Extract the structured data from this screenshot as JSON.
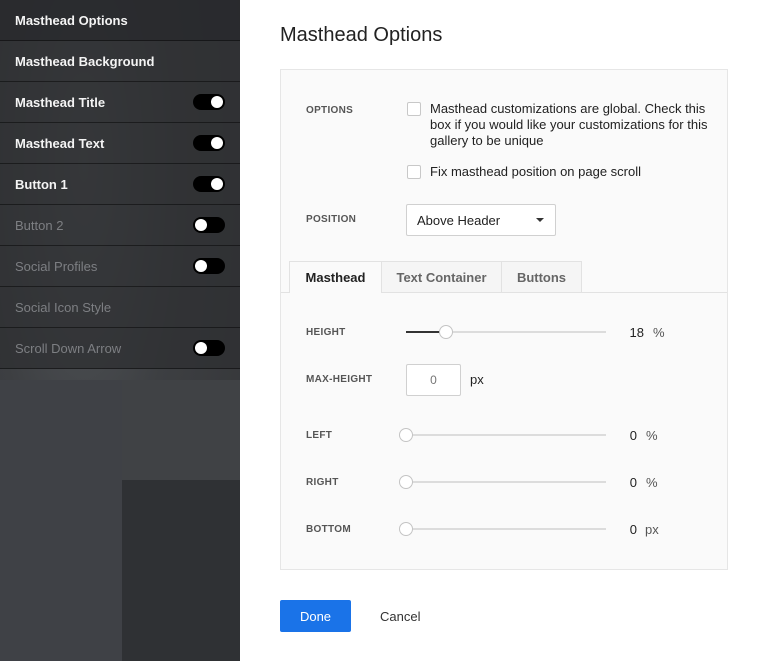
{
  "sidebar": {
    "items": [
      {
        "label": "Masthead Options",
        "toggle": null,
        "enabled": true
      },
      {
        "label": "Masthead Background",
        "toggle": null,
        "enabled": true
      },
      {
        "label": "Masthead Title",
        "toggle": "on",
        "enabled": true
      },
      {
        "label": "Masthead Text",
        "toggle": "on",
        "enabled": true
      },
      {
        "label": "Button 1",
        "toggle": "on",
        "enabled": true
      },
      {
        "label": "Button 2",
        "toggle": "off",
        "enabled": false
      },
      {
        "label": "Social Profiles",
        "toggle": "off",
        "enabled": false
      },
      {
        "label": "Social Icon Style",
        "toggle": null,
        "enabled": false
      },
      {
        "label": "Scroll Down Arrow",
        "toggle": "off",
        "enabled": false
      }
    ]
  },
  "main": {
    "title": "Masthead Options",
    "options": {
      "label": "OPTIONS",
      "global_checkbox": {
        "text": "Masthead customizations are global. Check this box if you would like your customizations for this gallery to be unique",
        "checked": false
      },
      "fix_checkbox": {
        "text": "Fix masthead position on page scroll",
        "checked": false
      }
    },
    "position": {
      "label": "POSITION",
      "value": "Above Header"
    },
    "tabs": [
      {
        "label": "Masthead",
        "active": true
      },
      {
        "label": "Text Container",
        "active": false
      },
      {
        "label": "Buttons",
        "active": false
      }
    ],
    "height": {
      "label": "HEIGHT",
      "value": "18",
      "unit": "%",
      "fraction": 0.2
    },
    "max_height": {
      "label": "MAX-HEIGHT",
      "placeholder": "0",
      "unit": "px"
    },
    "left": {
      "label": "LEFT",
      "value": "0",
      "unit": "%",
      "fraction": 0
    },
    "right": {
      "label": "RIGHT",
      "value": "0",
      "unit": "%",
      "fraction": 0
    },
    "bottom": {
      "label": "BOTTOM",
      "value": "0",
      "unit": "px",
      "fraction": 0
    },
    "done_label": "Done",
    "cancel_label": "Cancel"
  },
  "colors": {
    "accent": "#1a73e8",
    "sidebar": "#3a3b3d"
  }
}
